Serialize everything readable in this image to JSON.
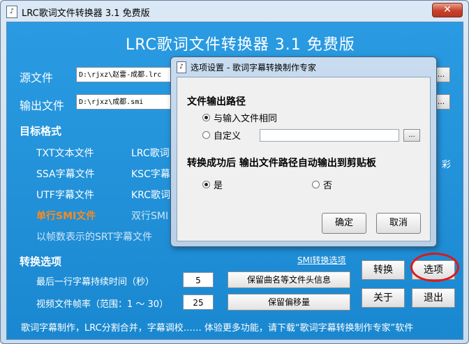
{
  "window": {
    "title": "LRC歌词文件转换器 3.1 免费版",
    "close": "✕"
  },
  "main": {
    "banner": "LRC歌词文件转换器 3.1 免费版",
    "source_label": "源文件",
    "source_value": "D:\\rjxz\\赵雷-成都.lrc",
    "output_label": "输出文件",
    "output_value": "D:\\rjxz\\成都.smi",
    "browse": "...",
    "target_label": "目标格式",
    "formats": {
      "txt": "TXT文本文件",
      "lrc": "LRC歌词",
      "ssa": "SSA字幕文件",
      "ksc": "KSC字幕",
      "utf": "UTF字幕文件",
      "krc": "KRC歌词",
      "smi": "单行SMI文件",
      "smi2": "双行SMI",
      "srt": "以帧数表示的SRT字幕文件"
    },
    "side_text": "彩",
    "convert_label": "转换选项",
    "smi_link": "SMI转换选项",
    "last_line_label": "最后一行字幕持续时间（秒）",
    "last_line_value": "5",
    "keep_header": "保留曲名等文件头信息",
    "fps_label": "视频文件帧率（范围：1 ～ 30）",
    "fps_value": "25",
    "keep_offset": "保留偏移量",
    "btn_convert": "转换",
    "btn_options": "选项",
    "btn_about": "关于",
    "btn_exit": "退出",
    "footer": "歌词字幕制作，LRC分割合并，字幕调校…… 体验更多功能，请下载“歌词字幕转换制作专家”软件"
  },
  "dialog": {
    "title": "选项设置 - 歌词字幕转换制作专家",
    "path_header": "文件输出路径",
    "same_as_input": "与输入文件相同",
    "custom": "自定义",
    "custom_value": "",
    "browse": "...",
    "clipboard_header": "转换成功后 输出文件路径自动输出到剪贴板",
    "yes": "是",
    "no": "否",
    "ok": "确定",
    "cancel": "取消"
  }
}
